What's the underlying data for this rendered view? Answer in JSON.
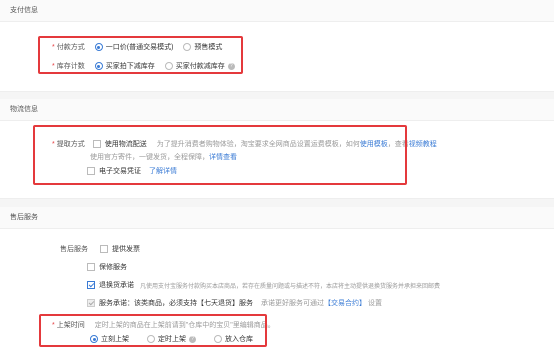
{
  "payment": {
    "header": "支付信息",
    "method_label": "付款方式",
    "method_opt1": "一口价(普通交易模式)",
    "method_opt2": "预售模式",
    "stock_label": "库存计数",
    "stock_opt1": "买家拍下减库存",
    "stock_opt2": "买家付款减库存"
  },
  "logistics": {
    "header": "物流信息",
    "pickup_label": "提取方式",
    "logistics_option": "使用物流配送",
    "logistics_hint": "为了提升消费者购物体验，淘宝要求全网商品设置运费模板，如何",
    "logistics_link1": "使用模板",
    "logistics_hint2": "，查看",
    "logistics_link2": "视频教程",
    "logistics_hint3": "使用官方寄件，一键发货，全程保障，",
    "logistics_link3": "详情查看",
    "evoucher_option": "电子交易凭证",
    "evoucher_link": "了解详情"
  },
  "aftersale": {
    "header": "售后服务",
    "service_label": "售后服务",
    "opt_invoice": "提供发票",
    "opt_warranty": "保修服务",
    "opt_return": "退换货承诺",
    "return_hint": "凡使用支付宝服务付款购买本店商品，若存在质量问题或与描述不符，本店将主动提供退换货服务并承担来回邮费",
    "opt_promise": "服务承诺：该类商品，必须支持【七天退货】服务",
    "promise_hint": "承诺更好服务可通过",
    "promise_link": "【交易合约】",
    "promise_tail": "设置",
    "listing_label": "上架时间",
    "listing_hint": "定时上架的商品在上架前请到\"仓库中的宝贝\"里编辑商品。",
    "listing_opt1": "立刻上架",
    "listing_opt2": "定时上架",
    "listing_opt3": "放入仓库"
  },
  "colors": {
    "highlight": "#e4393c",
    "accent": "#3a7bd5"
  }
}
